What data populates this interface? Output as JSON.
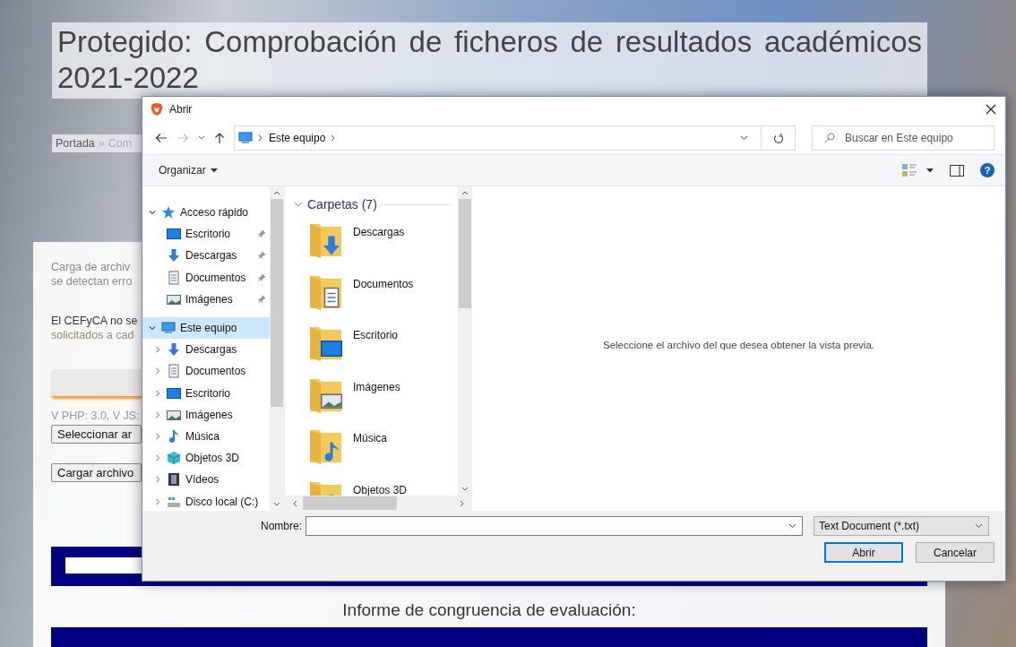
{
  "page": {
    "title": "Protegido: Comprobación de ficheros de resultados académicos 2021-2022",
    "breadcrumb": {
      "items": [
        "Portada",
        "Com"
      ],
      "separator": "»"
    },
    "intro_lines": [
      "Carga de archiv",
      "se detectan erro"
    ],
    "notice_lines": [
      "El CEFyCA no se",
      "solicitados a cad"
    ],
    "version": "V PHP: 3.0, V JS:",
    "select_button": "Seleccionar ar",
    "upload_button": "Cargar archivo",
    "report_heading": "Informe de congruencia de evaluación:"
  },
  "dialog": {
    "title": "Abrir",
    "address": "Este equipo",
    "search": {
      "placeholder": "Buscar en Este equipo"
    },
    "organize": "Organizar",
    "help": "?",
    "nav_tree": [
      {
        "name": "Acceso rápido",
        "kind": "quick",
        "expanded": true,
        "selected": false,
        "children": [
          {
            "name": "Escritorio",
            "kind": "desktop",
            "pinned": true,
            "selected": false
          },
          {
            "name": "Descargas",
            "kind": "downloads",
            "pinned": true,
            "selected": false
          },
          {
            "name": "Documentos",
            "kind": "documents",
            "pinned": true,
            "selected": false
          },
          {
            "name": "Imágenes",
            "kind": "pictures",
            "pinned": true,
            "selected": false
          }
        ]
      },
      {
        "name": "Este equipo",
        "kind": "pc",
        "expanded": true,
        "selected": true,
        "children": [
          {
            "name": "Descargas",
            "kind": "downloads",
            "expanded": false,
            "selected": false
          },
          {
            "name": "Documentos",
            "kind": "documents",
            "expanded": false,
            "selected": false
          },
          {
            "name": "Escritorio",
            "kind": "desktop",
            "expanded": false,
            "selected": false
          },
          {
            "name": "Imágenes",
            "kind": "pictures",
            "expanded": false,
            "selected": false
          },
          {
            "name": "Música",
            "kind": "music",
            "expanded": false,
            "selected": false
          },
          {
            "name": "Objetos 3D",
            "kind": "objects",
            "expanded": false,
            "selected": false
          },
          {
            "name": "Vídeos",
            "kind": "videos",
            "expanded": false,
            "selected": false
          },
          {
            "name": "Disco local (C:)",
            "kind": "disk",
            "expanded": false,
            "selected": false
          }
        ]
      }
    ],
    "folders": {
      "heading": "Carpetas (7)",
      "expanded": true,
      "items": [
        {
          "name": "Descargas",
          "kind": "downloads"
        },
        {
          "name": "Documentos",
          "kind": "documents"
        },
        {
          "name": "Escritorio",
          "kind": "desktop"
        },
        {
          "name": "Imágenes",
          "kind": "pictures"
        },
        {
          "name": "Música",
          "kind": "music"
        },
        {
          "name": "Objetos 3D",
          "kind": "objects"
        }
      ]
    },
    "preview_message": "Seleccione el archivo del que desea obtener la vista previa.",
    "filename_label": "Nombre:",
    "file_type": "Text Document (*.txt)",
    "buttons": [
      {
        "label": "Abrir",
        "focused": true
      },
      {
        "label": "Cancelar",
        "focused": false
      }
    ]
  }
}
